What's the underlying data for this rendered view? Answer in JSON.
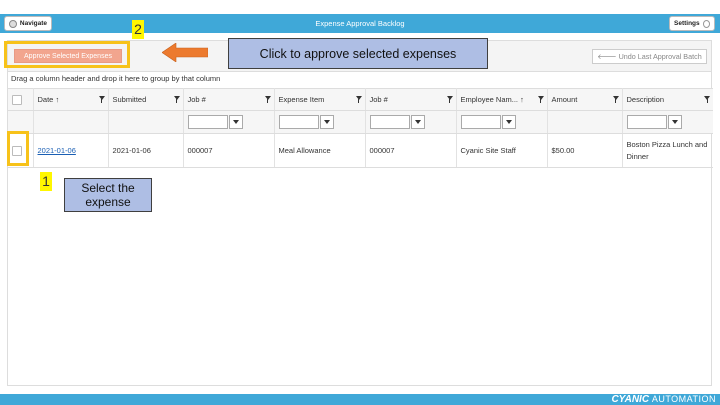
{
  "app": {
    "title": "Expense Approval Backlog",
    "navigate_label": "Navigate",
    "settings_label": "Settings"
  },
  "toolbar": {
    "approve_label": "Approve Selected Expenses",
    "undo_label": "Undo Last Approval Batch",
    "group_hint": "Drag a column header and drop it here to group by that column"
  },
  "grid": {
    "columns": [
      {
        "label": "Date",
        "sort": "↑"
      },
      {
        "label": "Submitted",
        "sort": ""
      },
      {
        "label": "Job #",
        "sort": ""
      },
      {
        "label": "Expense Item",
        "sort": ""
      },
      {
        "label": "Job #",
        "sort": ""
      },
      {
        "label": "Employee Nam...",
        "sort": "↑"
      },
      {
        "label": "Amount",
        "sort": ""
      },
      {
        "label": "Description",
        "sort": ""
      }
    ],
    "rows": [
      {
        "date": "2021-01-06",
        "submitted": "2021-01-06",
        "job1": "000007",
        "expense_item": "Meal Allowance",
        "job2": "000007",
        "employee": "Cyanic Site Staff",
        "amount": "$50.00",
        "description": "Boston Pizza Lunch and Dinner"
      }
    ]
  },
  "annotations": {
    "step1_num": "1",
    "step1_text": "Select the expense",
    "step2_num": "2",
    "step2_text": "Click to approve selected expenses"
  },
  "footer": {
    "brand": "CYANIC",
    "brand_sub": "AUTOMATION"
  },
  "colors": {
    "brand_blue": "#3fa8d8",
    "approve_button": "#f2a58e",
    "callout_fill": "#aebee4",
    "highlight_yellow": "#f7c21a",
    "arrow_orange": "#ec7a2e",
    "link_blue": "#1a5fb4"
  }
}
